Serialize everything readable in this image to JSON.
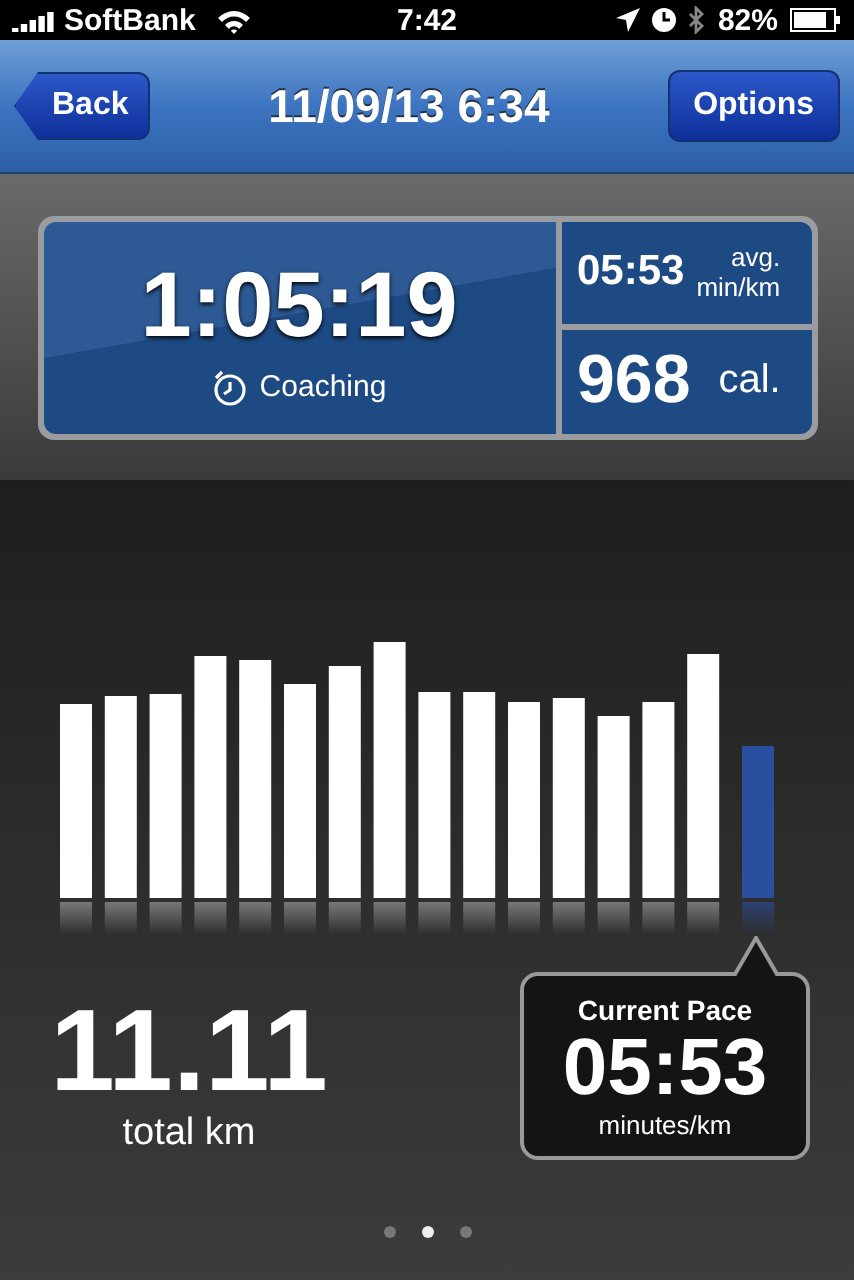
{
  "status_bar": {
    "carrier": "SoftBank",
    "time": "7:42",
    "battery": "82%"
  },
  "nav_bar": {
    "back": "Back",
    "title": "11/09/13 6:34",
    "options": "Options"
  },
  "summary": {
    "duration": "1:05:19",
    "coaching": "Coaching",
    "avg_pace": "05:53",
    "avg_label_1": "avg.",
    "avg_label_2": "min/km",
    "calories": "968",
    "calories_unit": "cal."
  },
  "distance": {
    "value": "11.11",
    "unit": "total km"
  },
  "current_pace": {
    "title": "Current Pace",
    "value": "05:53",
    "unit": "minutes/km"
  },
  "page_dots": [
    {
      "selected": false
    },
    {
      "selected": true
    },
    {
      "selected": false
    }
  ]
}
